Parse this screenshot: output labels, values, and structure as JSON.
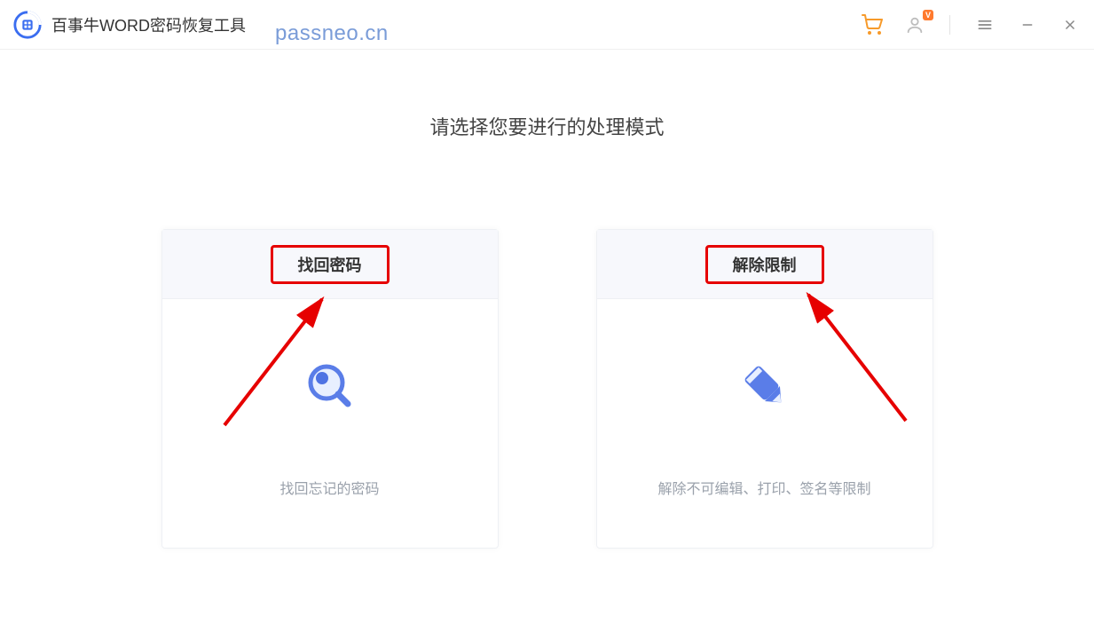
{
  "app": {
    "title": "百事牛WORD密码恢复工具",
    "watermark": "passneo.cn"
  },
  "heading": "请选择您要进行的处理模式",
  "cards": [
    {
      "title": "找回密码",
      "desc": "找回忘记的密码"
    },
    {
      "title": "解除限制",
      "desc": "解除不可编辑、打印、签名等限制"
    }
  ]
}
